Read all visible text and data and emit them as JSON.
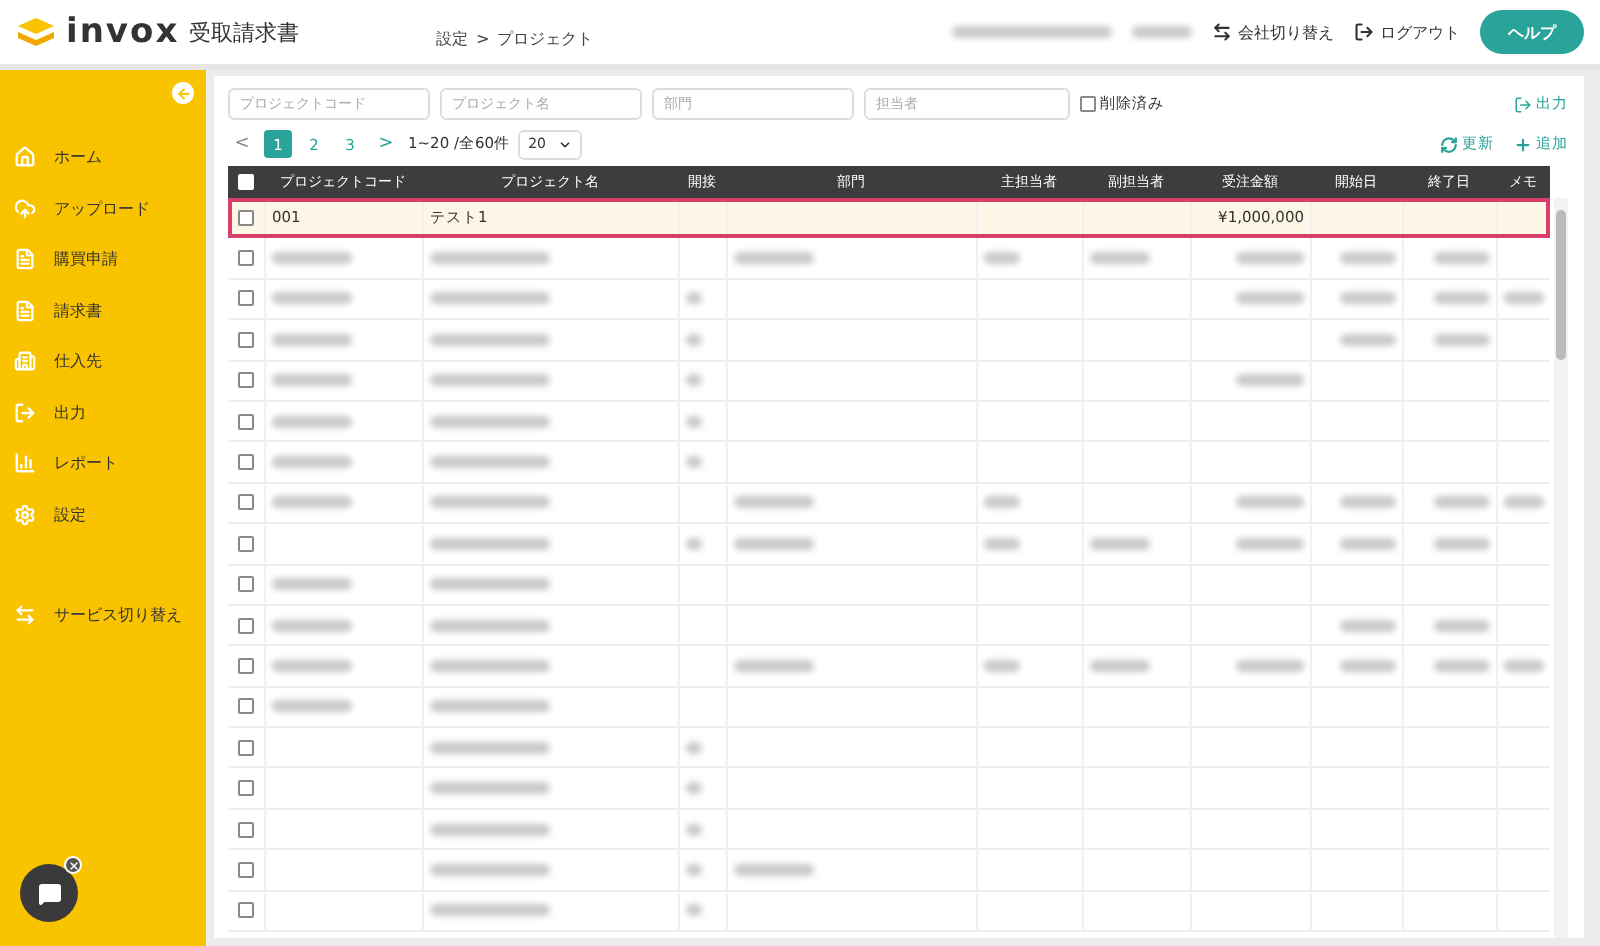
{
  "app": {
    "logo_text": "invox",
    "product": "受取請求書"
  },
  "breadcrumb": [
    "設定",
    ">",
    "プロジェクト"
  ],
  "header_actions": [
    {
      "kind": "switch",
      "label": "会社切り替え"
    },
    {
      "kind": "logout",
      "label": "ログアウト"
    },
    {
      "kind": "help",
      "label": "ヘルプ"
    }
  ],
  "sidebar": {
    "items": [
      {
        "label": "ホーム"
      },
      {
        "label": "アップロード"
      },
      {
        "label": "購買申請"
      },
      {
        "label": "請求書"
      },
      {
        "label": "仕入先"
      },
      {
        "label": "出力"
      },
      {
        "label": "レポート"
      },
      {
        "label": "設定"
      }
    ],
    "service_switch": "サービス切り替え"
  },
  "filters": {
    "fields": [
      {
        "placeholder": "プロジェクトコード"
      },
      {
        "placeholder": "プロジェクト名"
      },
      {
        "placeholder": "部門"
      },
      {
        "placeholder": "担当者"
      }
    ],
    "deleted": {
      "label": "削除済み",
      "checked": false
    },
    "export": "出力"
  },
  "pagination": {
    "prev": "<",
    "pages": [
      {
        "label": "1",
        "selected": true
      },
      {
        "label": "2",
        "selected": false
      },
      {
        "label": "3",
        "selected": false
      }
    ],
    "next": ">",
    "range": "1~20 /全60件",
    "page_size": "20"
  },
  "toolbar": [
    {
      "kind": "refresh",
      "label": "更新"
    },
    {
      "kind": "add",
      "label": "追加"
    }
  ],
  "table": {
    "select_all": {
      "checked": false
    },
    "columns": [
      "プロジェクトコード",
      "プロジェクト名",
      "開接",
      "部門",
      "主担当者",
      "副担当者",
      "受注金額",
      "開始日",
      "終了日",
      "メモ"
    ],
    "rows": [
      {
        "kind": "data",
        "selected": true,
        "cells": [
          "001",
          "テスト1",
          "",
          "",
          "",
          "",
          "¥1,000,000",
          "",
          "",
          ""
        ]
      },
      {
        "kind": "redacted",
        "selected": false,
        "cells": [
          true,
          true,
          false,
          true,
          true,
          true,
          true,
          true,
          true,
          false
        ]
      },
      {
        "kind": "redacted",
        "selected": false,
        "cells": [
          true,
          true,
          true,
          false,
          false,
          false,
          true,
          true,
          true,
          true
        ]
      },
      {
        "kind": "redacted",
        "selected": false,
        "cells": [
          true,
          true,
          true,
          false,
          false,
          false,
          false,
          true,
          true,
          false
        ]
      },
      {
        "kind": "redacted",
        "selected": false,
        "cells": [
          true,
          true,
          true,
          false,
          false,
          false,
          true,
          false,
          false,
          false
        ]
      },
      {
        "kind": "redacted",
        "selected": false,
        "cells": [
          true,
          true,
          true,
          false,
          false,
          false,
          false,
          false,
          false,
          false
        ]
      },
      {
        "kind": "redacted",
        "selected": false,
        "cells": [
          true,
          true,
          true,
          false,
          false,
          false,
          false,
          false,
          false,
          false
        ]
      },
      {
        "kind": "redacted",
        "selected": false,
        "cells": [
          true,
          true,
          false,
          true,
          true,
          false,
          true,
          true,
          true,
          true
        ]
      },
      {
        "kind": "redacted",
        "selected": false,
        "cells": [
          false,
          true,
          true,
          true,
          true,
          true,
          true,
          true,
          true,
          false
        ]
      },
      {
        "kind": "redacted",
        "selected": false,
        "cells": [
          true,
          true,
          false,
          false,
          false,
          false,
          false,
          false,
          false,
          false
        ]
      },
      {
        "kind": "redacted",
        "selected": false,
        "cells": [
          true,
          true,
          false,
          false,
          false,
          false,
          false,
          true,
          true,
          false
        ]
      },
      {
        "kind": "redacted",
        "selected": false,
        "cells": [
          true,
          true,
          false,
          true,
          true,
          true,
          true,
          true,
          true,
          true
        ]
      },
      {
        "kind": "redacted",
        "selected": false,
        "cells": [
          true,
          true,
          false,
          false,
          false,
          false,
          false,
          false,
          false,
          false
        ]
      },
      {
        "kind": "redacted",
        "selected": false,
        "cells": [
          false,
          true,
          true,
          false,
          false,
          false,
          false,
          false,
          false,
          false
        ]
      },
      {
        "kind": "redacted",
        "selected": false,
        "cells": [
          false,
          true,
          true,
          false,
          false,
          false,
          false,
          false,
          false,
          false
        ]
      },
      {
        "kind": "redacted",
        "selected": false,
        "cells": [
          false,
          true,
          true,
          false,
          false,
          false,
          false,
          false,
          false,
          false
        ]
      },
      {
        "kind": "redacted",
        "selected": false,
        "cells": [
          false,
          true,
          true,
          true,
          false,
          false,
          false,
          false,
          false,
          false
        ]
      },
      {
        "kind": "redacted",
        "selected": false,
        "cells": [
          false,
          true,
          true,
          false,
          false,
          false,
          false,
          false,
          false,
          false
        ]
      }
    ]
  }
}
